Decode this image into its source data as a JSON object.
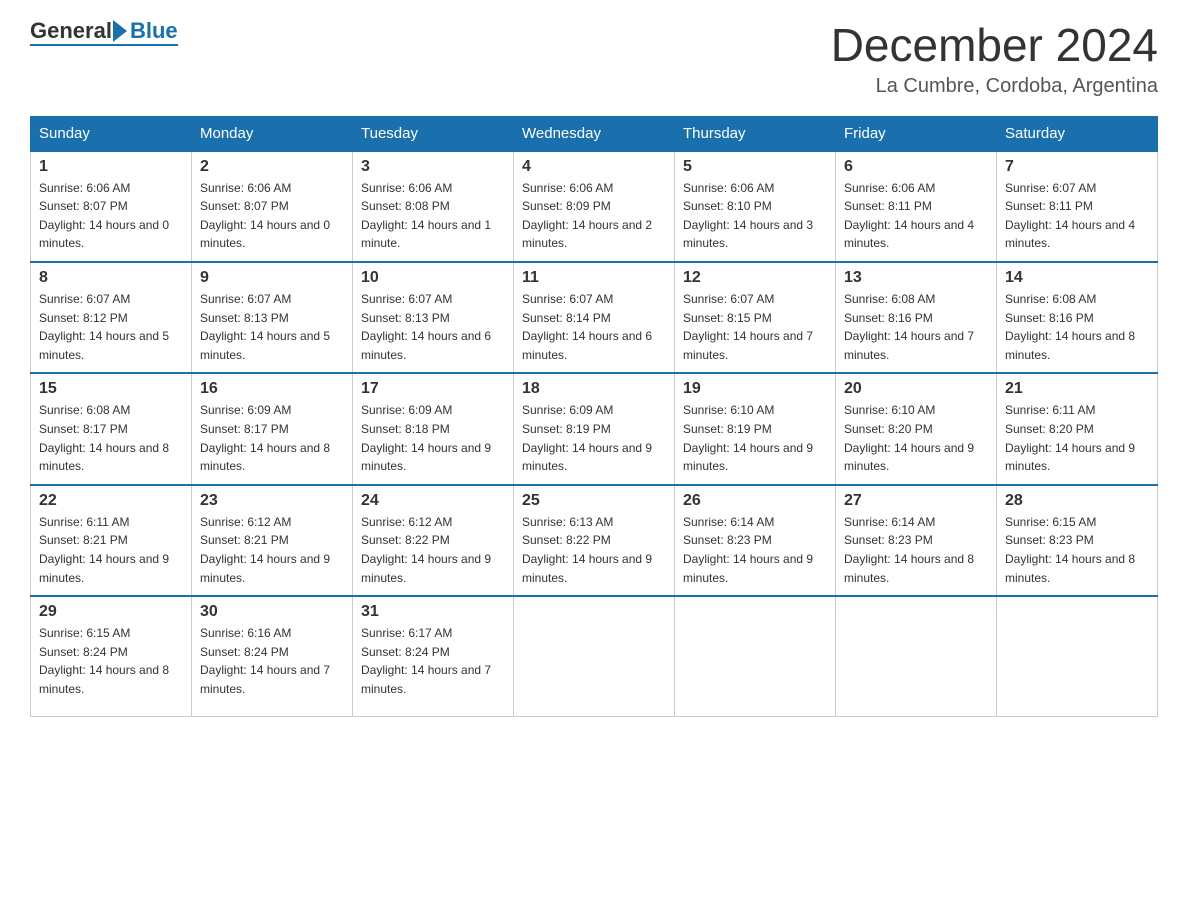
{
  "logo": {
    "general": "General",
    "blue": "Blue"
  },
  "header": {
    "month": "December 2024",
    "location": "La Cumbre, Cordoba, Argentina"
  },
  "days_header": [
    "Sunday",
    "Monday",
    "Tuesday",
    "Wednesday",
    "Thursday",
    "Friday",
    "Saturday"
  ],
  "weeks": [
    [
      {
        "day": "1",
        "sunrise": "6:06 AM",
        "sunset": "8:07 PM",
        "daylight": "14 hours and 0 minutes."
      },
      {
        "day": "2",
        "sunrise": "6:06 AM",
        "sunset": "8:07 PM",
        "daylight": "14 hours and 0 minutes."
      },
      {
        "day": "3",
        "sunrise": "6:06 AM",
        "sunset": "8:08 PM",
        "daylight": "14 hours and 1 minute."
      },
      {
        "day": "4",
        "sunrise": "6:06 AM",
        "sunset": "8:09 PM",
        "daylight": "14 hours and 2 minutes."
      },
      {
        "day": "5",
        "sunrise": "6:06 AM",
        "sunset": "8:10 PM",
        "daylight": "14 hours and 3 minutes."
      },
      {
        "day": "6",
        "sunrise": "6:06 AM",
        "sunset": "8:11 PM",
        "daylight": "14 hours and 4 minutes."
      },
      {
        "day": "7",
        "sunrise": "6:07 AM",
        "sunset": "8:11 PM",
        "daylight": "14 hours and 4 minutes."
      }
    ],
    [
      {
        "day": "8",
        "sunrise": "6:07 AM",
        "sunset": "8:12 PM",
        "daylight": "14 hours and 5 minutes."
      },
      {
        "day": "9",
        "sunrise": "6:07 AM",
        "sunset": "8:13 PM",
        "daylight": "14 hours and 5 minutes."
      },
      {
        "day": "10",
        "sunrise": "6:07 AM",
        "sunset": "8:13 PM",
        "daylight": "14 hours and 6 minutes."
      },
      {
        "day": "11",
        "sunrise": "6:07 AM",
        "sunset": "8:14 PM",
        "daylight": "14 hours and 6 minutes."
      },
      {
        "day": "12",
        "sunrise": "6:07 AM",
        "sunset": "8:15 PM",
        "daylight": "14 hours and 7 minutes."
      },
      {
        "day": "13",
        "sunrise": "6:08 AM",
        "sunset": "8:16 PM",
        "daylight": "14 hours and 7 minutes."
      },
      {
        "day": "14",
        "sunrise": "6:08 AM",
        "sunset": "8:16 PM",
        "daylight": "14 hours and 8 minutes."
      }
    ],
    [
      {
        "day": "15",
        "sunrise": "6:08 AM",
        "sunset": "8:17 PM",
        "daylight": "14 hours and 8 minutes."
      },
      {
        "day": "16",
        "sunrise": "6:09 AM",
        "sunset": "8:17 PM",
        "daylight": "14 hours and 8 minutes."
      },
      {
        "day": "17",
        "sunrise": "6:09 AM",
        "sunset": "8:18 PM",
        "daylight": "14 hours and 9 minutes."
      },
      {
        "day": "18",
        "sunrise": "6:09 AM",
        "sunset": "8:19 PM",
        "daylight": "14 hours and 9 minutes."
      },
      {
        "day": "19",
        "sunrise": "6:10 AM",
        "sunset": "8:19 PM",
        "daylight": "14 hours and 9 minutes."
      },
      {
        "day": "20",
        "sunrise": "6:10 AM",
        "sunset": "8:20 PM",
        "daylight": "14 hours and 9 minutes."
      },
      {
        "day": "21",
        "sunrise": "6:11 AM",
        "sunset": "8:20 PM",
        "daylight": "14 hours and 9 minutes."
      }
    ],
    [
      {
        "day": "22",
        "sunrise": "6:11 AM",
        "sunset": "8:21 PM",
        "daylight": "14 hours and 9 minutes."
      },
      {
        "day": "23",
        "sunrise": "6:12 AM",
        "sunset": "8:21 PM",
        "daylight": "14 hours and 9 minutes."
      },
      {
        "day": "24",
        "sunrise": "6:12 AM",
        "sunset": "8:22 PM",
        "daylight": "14 hours and 9 minutes."
      },
      {
        "day": "25",
        "sunrise": "6:13 AM",
        "sunset": "8:22 PM",
        "daylight": "14 hours and 9 minutes."
      },
      {
        "day": "26",
        "sunrise": "6:14 AM",
        "sunset": "8:23 PM",
        "daylight": "14 hours and 9 minutes."
      },
      {
        "day": "27",
        "sunrise": "6:14 AM",
        "sunset": "8:23 PM",
        "daylight": "14 hours and 8 minutes."
      },
      {
        "day": "28",
        "sunrise": "6:15 AM",
        "sunset": "8:23 PM",
        "daylight": "14 hours and 8 minutes."
      }
    ],
    [
      {
        "day": "29",
        "sunrise": "6:15 AM",
        "sunset": "8:24 PM",
        "daylight": "14 hours and 8 minutes."
      },
      {
        "day": "30",
        "sunrise": "6:16 AM",
        "sunset": "8:24 PM",
        "daylight": "14 hours and 7 minutes."
      },
      {
        "day": "31",
        "sunrise": "6:17 AM",
        "sunset": "8:24 PM",
        "daylight": "14 hours and 7 minutes."
      },
      {
        "day": "",
        "sunrise": "",
        "sunset": "",
        "daylight": ""
      },
      {
        "day": "",
        "sunrise": "",
        "sunset": "",
        "daylight": ""
      },
      {
        "day": "",
        "sunrise": "",
        "sunset": "",
        "daylight": ""
      },
      {
        "day": "",
        "sunrise": "",
        "sunset": "",
        "daylight": ""
      }
    ]
  ]
}
